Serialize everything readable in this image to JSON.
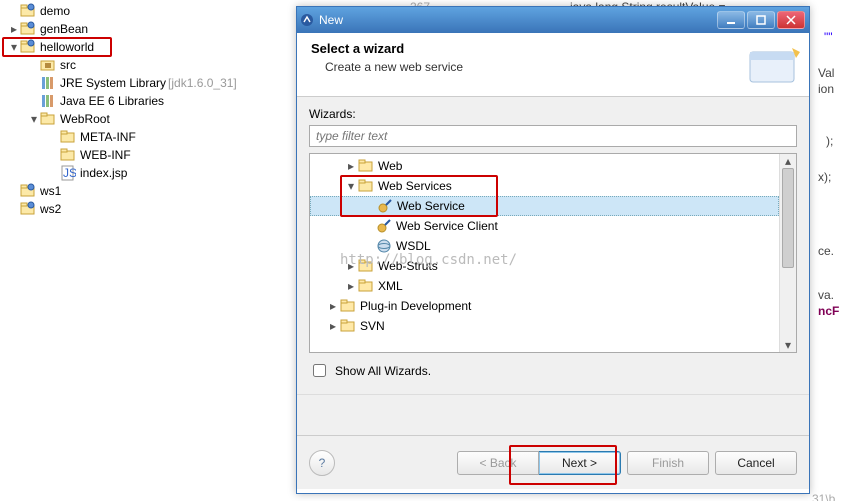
{
  "explorer": {
    "items": [
      {
        "label": "demo",
        "icon": "project-open-icon",
        "indent": 0,
        "twisty": ""
      },
      {
        "label": "genBean",
        "icon": "project-open-icon",
        "indent": 0,
        "twisty": "▸"
      },
      {
        "label": "helloworld",
        "icon": "project-open-icon",
        "indent": 0,
        "twisty": "▾",
        "boxed": true
      },
      {
        "label": "src",
        "icon": "package-folder-icon",
        "indent": 1,
        "twisty": ""
      },
      {
        "label": "JRE System Library",
        "decor": "[jdk1.6.0_31]",
        "icon": "library-icon",
        "indent": 1,
        "twisty": ""
      },
      {
        "label": "Java EE 6 Libraries",
        "icon": "library-icon",
        "indent": 1,
        "twisty": ""
      },
      {
        "label": "WebRoot",
        "icon": "folder-open-icon",
        "indent": 1,
        "twisty": "▾"
      },
      {
        "label": "META-INF",
        "icon": "folder-open-icon",
        "indent": 2,
        "twisty": ""
      },
      {
        "label": "WEB-INF",
        "icon": "folder-open-icon",
        "indent": 2,
        "twisty": ""
      },
      {
        "label": "index.jsp",
        "icon": "jsp-file-icon",
        "indent": 2,
        "twisty": ""
      },
      {
        "label": "ws1",
        "icon": "project-open-icon",
        "indent": 0,
        "twisty": ""
      },
      {
        "label": "ws2",
        "icon": "project-open-icon",
        "indent": 0,
        "twisty": ""
      }
    ]
  },
  "dialog": {
    "title": "New",
    "banner": {
      "title": "Select a wizard",
      "desc": "Create a new web service"
    },
    "wizards_label": "Wizards:",
    "filter_placeholder": "type filter text",
    "show_all": "Show All Wizards.",
    "tree": [
      {
        "label": "Web",
        "icon": "folder-closed-icon",
        "indent": 1,
        "twisty": "▸"
      },
      {
        "label": "Web Services",
        "icon": "folder-open-icon",
        "indent": 1,
        "twisty": "▾",
        "group_boxed": true
      },
      {
        "label": "Web Service",
        "icon": "wizard-item-icon",
        "indent": 2,
        "twisty": "",
        "selected": true
      },
      {
        "label": "Web Service Client",
        "icon": "wizard-item-icon",
        "indent": 2,
        "twisty": ""
      },
      {
        "label": "WSDL",
        "icon": "wsdl-icon",
        "indent": 2,
        "twisty": ""
      },
      {
        "label": "Web-Struts",
        "icon": "folder-closed-icon",
        "indent": 1,
        "twisty": "▸"
      },
      {
        "label": "XML",
        "icon": "folder-closed-icon",
        "indent": 1,
        "twisty": "▸"
      },
      {
        "label": "Plug-in Development",
        "icon": "folder-closed-icon",
        "indent": 0,
        "twisty": "▸"
      },
      {
        "label": "SVN",
        "icon": "folder-closed-icon",
        "indent": 0,
        "twisty": "▸"
      }
    ],
    "buttons": {
      "back": "< Back",
      "next": "Next >",
      "finish": "Finish",
      "cancel": "Cancel"
    }
  },
  "code": {
    "l0": "267",
    "l1": "java.lang.String resultValue =",
    "l2": "\"\"",
    "l3": "Val",
    "l4": "ion",
    "l5": ");",
    "l6": "x);",
    "l7": "ce.",
    "l8": "va.",
    "l9": "ncF",
    "l10": "31\\b"
  },
  "watermark": "http://blog.csdn.net/",
  "colors": {
    "accent": "#3a74b8",
    "highlight": "#c00"
  }
}
